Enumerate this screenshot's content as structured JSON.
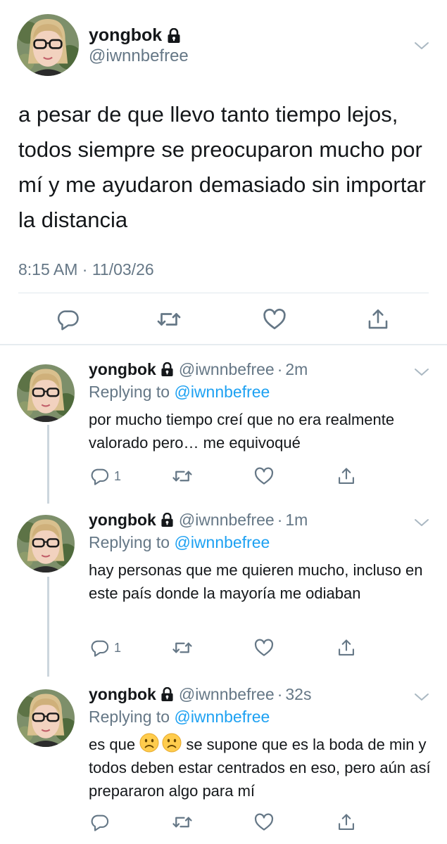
{
  "main_tweet": {
    "display_name": "yongbok",
    "handle": "@iwnnbefree",
    "text": "a pesar de que llevo tanto tiempo lejos, todos siempre se preocuparon mucho por mí y me ayudaron demasiado sin importar la distancia",
    "timestamp": "8:15 AM · 11/03/26",
    "icons": [
      "lock-icon",
      "chevron-down-icon",
      "reply-icon",
      "retweet-icon",
      "like-icon",
      "share-icon"
    ]
  },
  "replies": [
    {
      "display_name": "yongbok",
      "handle": "@iwnnbefree",
      "age": "2m",
      "replying_prefix": "Replying to",
      "replying_to": "@iwnnbefree",
      "text": "por mucho tiempo creí que no era realmente valorado pero… me equivoqué",
      "reply_count": "1"
    },
    {
      "display_name": "yongbok",
      "handle": "@iwnnbefree",
      "age": "1m",
      "replying_prefix": "Replying to",
      "replying_to": "@iwnnbefree",
      "text": "hay personas que me quieren mucho, incluso en este país donde la mayoría me odiaban",
      "reply_count": "1"
    },
    {
      "display_name": "yongbok",
      "handle": "@iwnnbefree",
      "age": "32s",
      "replying_prefix": "Replying to",
      "replying_to": "@iwnnbefree",
      "text_before": "es que",
      "text_after": "se supone que es la boda de min y todos deben estar centrados en eso, pero aún así prepararon algo para mí",
      "emojis": [
        "frowning-face",
        "frowning-face"
      ],
      "reply_count": ""
    }
  ],
  "colors": {
    "text": "#14171a",
    "secondary": "#657786",
    "link": "#1da1f2",
    "divider": "#e6ecf0",
    "icon": "#657786"
  }
}
